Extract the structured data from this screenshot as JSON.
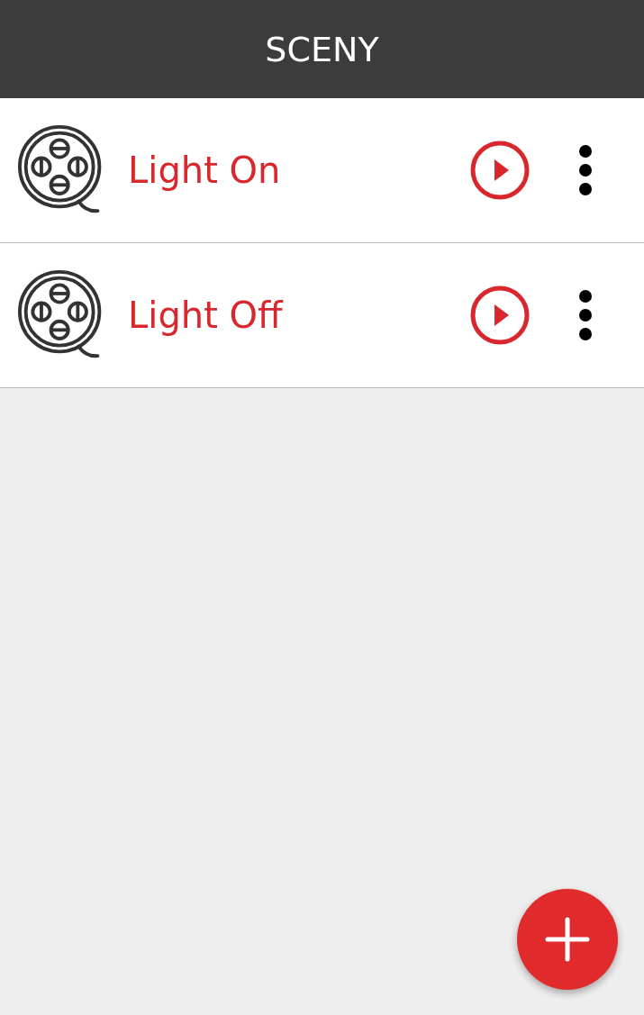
{
  "header": {
    "title": "SCENY"
  },
  "scenes": [
    {
      "name": "Light On"
    },
    {
      "name": "Light Off"
    }
  ]
}
